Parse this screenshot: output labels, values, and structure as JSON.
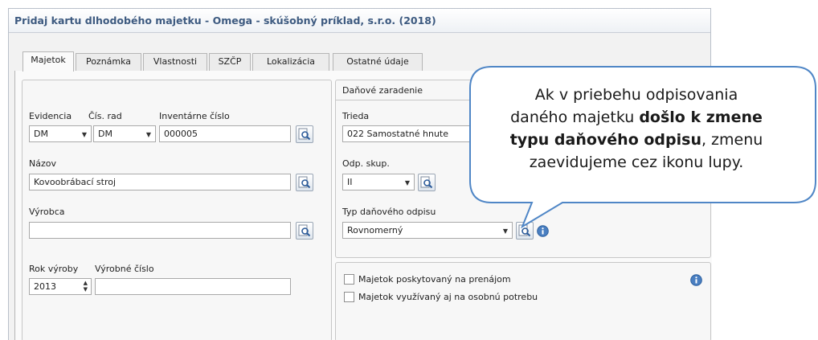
{
  "window": {
    "title": "Pridaj kartu dlhodobého majetku - Omega - skúšobný príklad, s.r.o. (2018)"
  },
  "tabs": [
    {
      "label": "Majetok",
      "active": true
    },
    {
      "label": "Poznámka",
      "active": false
    },
    {
      "label": "Vlastnosti",
      "active": false
    },
    {
      "label": "SZČP",
      "active": false
    },
    {
      "label": "Lokalizácia",
      "active": false
    },
    {
      "label": "Ostatné údaje",
      "active": false
    }
  ],
  "left": {
    "evidencia_label": "Evidencia",
    "evidencia_value": "DM",
    "cis_rad_label": "Čís. rad",
    "cis_rad_value": "DM",
    "inventarne_label": "Inventárne číslo",
    "inventarne_value": "000005",
    "nazov_label": "Názov",
    "nazov_value": "Kovoobrábací stroj",
    "vyrobca_label": "Výrobca",
    "vyrobca_value": "",
    "rok_label": "Rok výroby",
    "rok_value": "2013",
    "vyrobne_label": "Výrobné číslo",
    "vyrobne_value": ""
  },
  "right": {
    "group_title": "Daňové zaradenie",
    "trieda_label": "Trieda",
    "trieda_value": "022 Samostatné hnute",
    "odp_skup_label": "Odp. skup.",
    "odp_skup_value": "II",
    "typ_label": "Typ daňového odpisu",
    "typ_value": "Rovnomerný"
  },
  "checkboxes": {
    "prenajom_label": "Majetok poskytovaný na prenájom",
    "osobna_label": "Majetok využívaný aj na osobnú potrebu"
  },
  "callout": {
    "line1": "Ak v priebehu odpisovania",
    "line2_pre": "daného majetku ",
    "line2_bold": "došlo k zmene",
    "line3_bold": "typu daňového odpisu",
    "line3_post": ", zmenu",
    "line4": "zaevidujeme cez ikonu lupy."
  },
  "icons": {
    "lupa": "magnifier-lookup-icon",
    "info": "info-icon"
  },
  "colors": {
    "title": "#3d5a80",
    "info_blue": "#4a7fc1"
  }
}
